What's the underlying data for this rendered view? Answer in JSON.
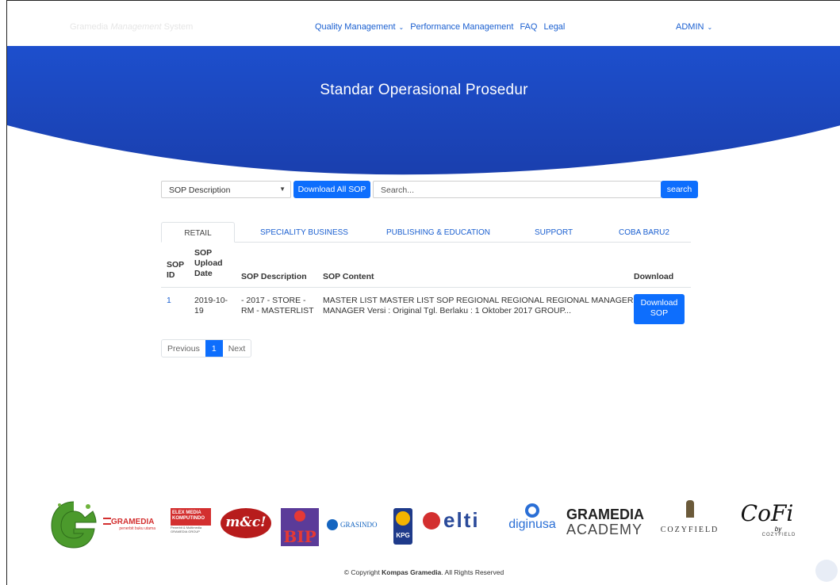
{
  "navbar": {
    "brand_prefix": "Gramedia",
    "brand_italic": "Management",
    "brand_suffix": "System",
    "links": [
      {
        "label": "Quality Management",
        "has_dropdown": true
      },
      {
        "label": "Performance Management",
        "has_dropdown": false
      },
      {
        "label": "FAQ",
        "has_dropdown": false
      },
      {
        "label": "Legal",
        "has_dropdown": false
      }
    ],
    "user": "ADMIN"
  },
  "hero": {
    "title": "Standar Operasional Prosedur",
    "color": "#1e4fc7"
  },
  "search": {
    "filter_selected": "SOP Description",
    "download_all_label": "Download All SOP",
    "placeholder": "Search...",
    "search_label": "search"
  },
  "tabs": [
    "RETAIL",
    "SPECIALITY BUSINESS",
    "PUBLISHING & EDUCATION",
    "SUPPORT",
    "COBA BARU2"
  ],
  "table": {
    "headers": {
      "id": [
        "SOP",
        "ID"
      ],
      "date": [
        "SOP",
        "Upload",
        "Date"
      ],
      "description": "SOP Description",
      "content": "SOP Content",
      "download": "Download"
    },
    "rows": [
      {
        "id": "1",
        "date": [
          "2019-10-",
          "19"
        ],
        "description": [
          "- 2017 - STORE -",
          "RM - MASTERLIST"
        ],
        "content": [
          "MASTER LIST MASTER LIST SOP REGIONAL REGIONAL REGIONAL MANAGER",
          "MANAGER Versi : Original Tgl. Berlaku : 1 Oktober 2017 GROUP..."
        ],
        "download_label": [
          "Download",
          "SOP"
        ]
      }
    ]
  },
  "pagination": {
    "previous": "Previous",
    "current": "1",
    "next": "Next"
  },
  "logos": {
    "gramedia": "GRAMEDIA",
    "gramedia_sub": "penerbit buku utama",
    "elex": "ELEX MEDIA KOMPUTINDO",
    "elex_sub": "Penerbit & Multimedia GRAMEDIA GROUP",
    "mc": "m&c!",
    "bip": "BIP",
    "grasindo": "GRASINDO",
    "kpg": "KPG",
    "elti": "elti",
    "diginusa": "diginusa",
    "academy_1": "GRAMEDIA",
    "academy_2": "ACADEMY",
    "cozyfield": "COZYFIELD",
    "cofi": "CoFi",
    "cofi_by": "by",
    "cofi_sub": "COZYFIELD"
  },
  "footer": {
    "prefix": "© Copyright ",
    "company": "Kompas Gramedia",
    "suffix": ". All Rights Reserved"
  }
}
